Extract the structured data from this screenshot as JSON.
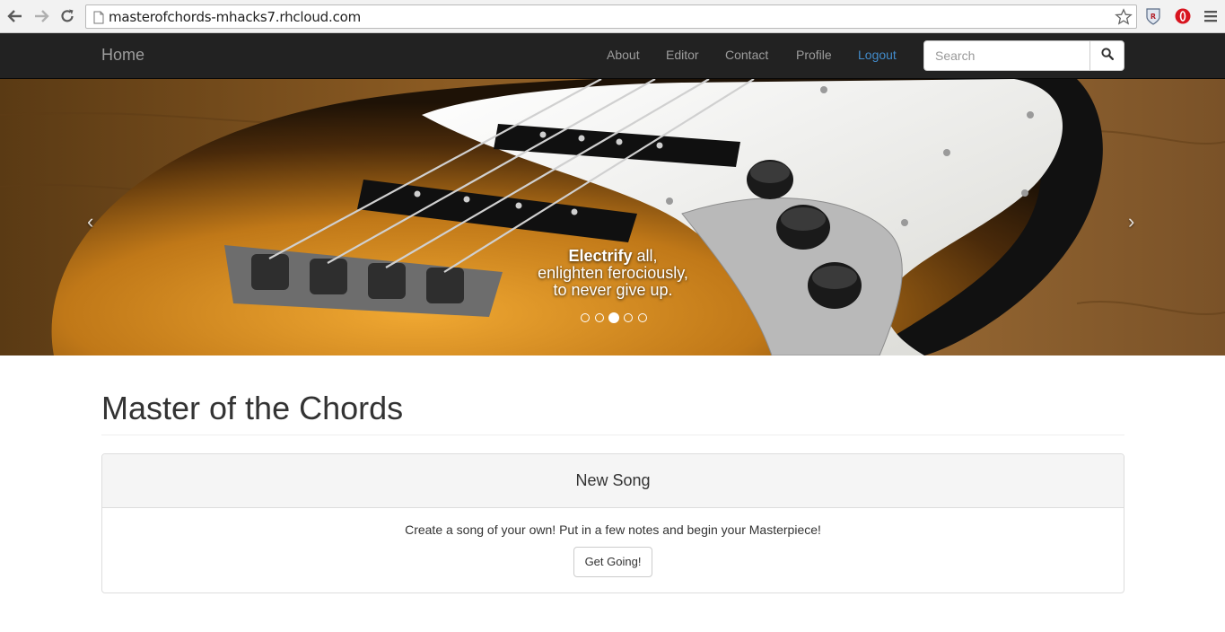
{
  "browser": {
    "url": "masterofchords-mhacks7.rhcloud.com",
    "icons": [
      "back-arrow-icon",
      "forward-arrow-icon",
      "reload-icon",
      "page-icon",
      "bookmark-star-icon",
      "shield-extension-icon",
      "opera-extension-icon",
      "menu-icon"
    ]
  },
  "navbar": {
    "brand": "Home",
    "links": [
      {
        "label": "About",
        "active": false
      },
      {
        "label": "Editor",
        "active": false
      },
      {
        "label": "Contact",
        "active": false
      },
      {
        "label": "Profile",
        "active": false
      },
      {
        "label": "Logout",
        "active": true
      }
    ],
    "search": {
      "placeholder": "Search",
      "value": "",
      "button_icon": "search-icon"
    },
    "colors": {
      "background": "#222222",
      "link": "#9d9d9d",
      "active_link": "#428bca"
    }
  },
  "carousel": {
    "caption": {
      "emphasis": "Electrify",
      "line1_rest": " all,",
      "line2": "enlighten ferociously,",
      "line3": "to never give up."
    },
    "prev_label": "‹",
    "next_label": "›",
    "slide_count": 5,
    "active_slide": 3
  },
  "main": {
    "title": "Master of the Chords",
    "panel": {
      "heading": "New Song",
      "text": "Create a song of your own! Put in a few notes and begin your Masterpiece!",
      "button": "Get Going!"
    }
  }
}
